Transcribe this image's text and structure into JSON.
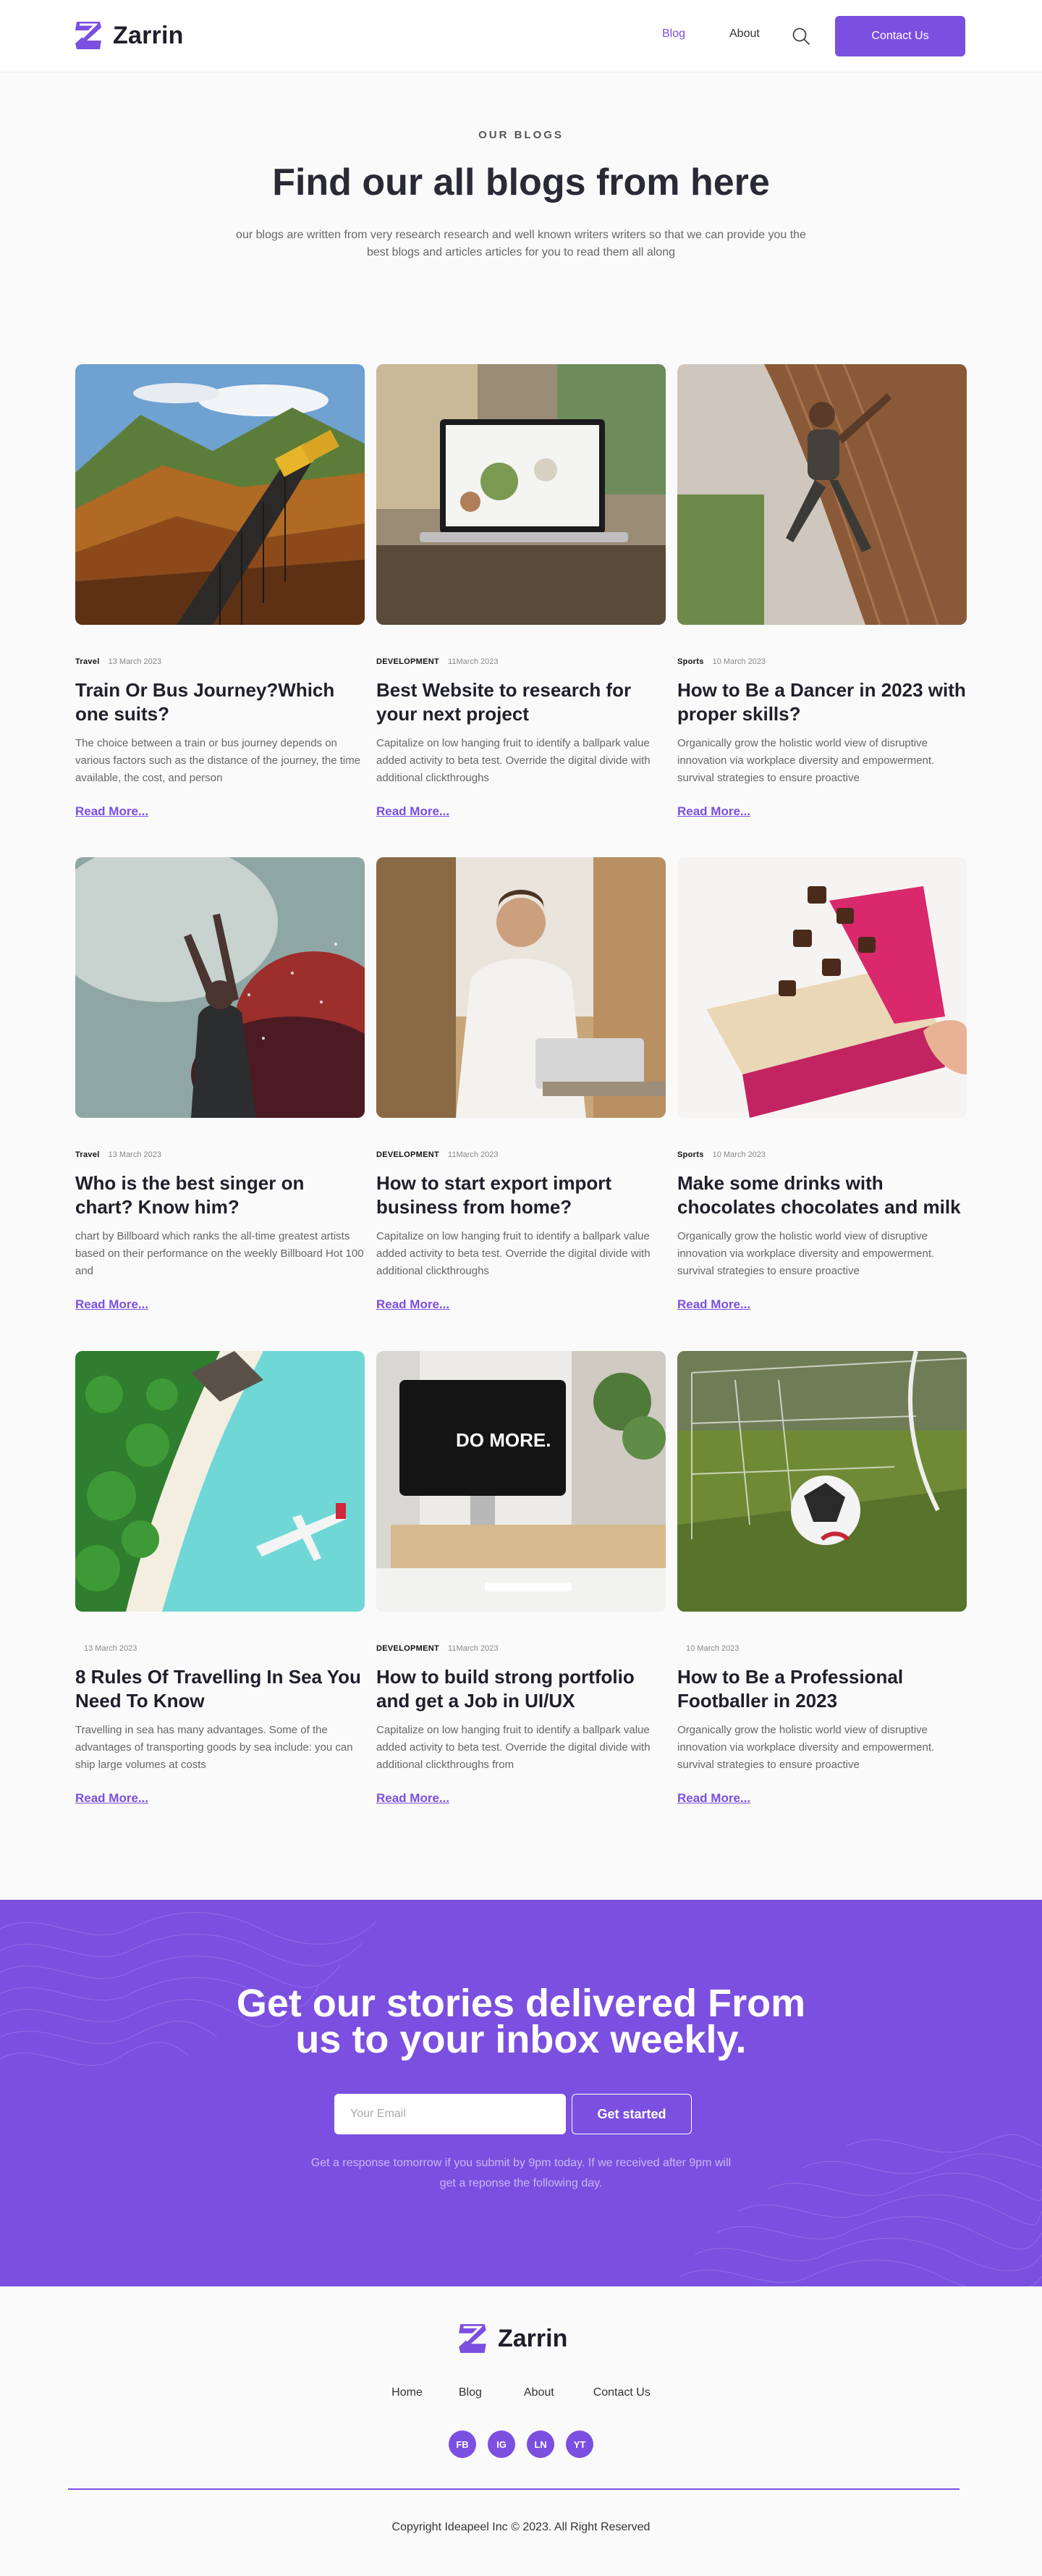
{
  "header": {
    "brand": "Zarrin",
    "nav": [
      {
        "label": "Blog"
      },
      {
        "label": "About"
      }
    ],
    "contact_label": "Contact Us"
  },
  "hero": {
    "eyebrow": "OUR BLOGS",
    "title": "Find our all blogs from here",
    "lead": "our blogs are written from very research research and well known writers writers so that  we can provide you the best blogs and articles articles for you to read them all along"
  },
  "posts": [
    {
      "category": "Travel",
      "date": "13 March 2023",
      "title": "Train Or Bus Journey?Which one suits?",
      "excerpt": "The choice between a train or bus journey depends on various factors such as the distance of the journey, the time available, the cost, and person",
      "more": "Read More..."
    },
    {
      "category": "DEVELOPMENT",
      "date": "11March 2023",
      "title": "Best Website to research for your next project",
      "excerpt": "Capitalize on low hanging fruit to identify a ballpark value added activity to beta test. Override the digital divide with additional clickthroughs",
      "more": "Read More..."
    },
    {
      "category": "Sports",
      "date": "10 March 2023",
      "title": "How to Be a Dancer in 2023 with proper skills?",
      "excerpt": "Organically grow the holistic world view of disruptive innovation via workplace diversity and empowerment. survival strategies to ensure proactive",
      "more": "Read More..."
    },
    {
      "category": "Travel",
      "date": "13 March 2023",
      "title": "Who is the best singer on chart? Know him?",
      "excerpt": "chart by Billboard which ranks the all-time greatest artists based on their performance on the weekly Billboard Hot 100 and",
      "more": "Read More..."
    },
    {
      "category": "DEVELOPMENT",
      "date": "11March 2023",
      "title": "How to start export import business from home?",
      "excerpt": "Capitalize on low hanging fruit to identify a ballpark value added activity to beta test. Override the digital divide with additional clickthroughs",
      "more": "Read More..."
    },
    {
      "category": "Sports",
      "date": "10 March 2023",
      "title": "Make some drinks with chocolates chocolates and milk",
      "excerpt": "Organically grow the holistic world view of disruptive innovation via workplace diversity and empowerment. survival strategies to ensure proactive",
      "more": "Read More..."
    },
    {
      "category": "",
      "date": "13 March 2023",
      "title": "8 Rules Of Travelling In Sea You Need To Know",
      "excerpt": "Travelling in sea has many advantages. Some of the advantages of transporting goods by sea include: you can ship large volumes at costs",
      "more": "Read More..."
    },
    {
      "category": "DEVELOPMENT",
      "date": "11March 2023",
      "title": "How to build strong portfolio and get a Job in UI/UX",
      "excerpt": "Capitalize on low hanging fruit to identify a ballpark value added activity to beta test. Override the digital divide with additional clickthroughs from",
      "more": "Read More..."
    },
    {
      "category": "",
      "date": "10 March 2023",
      "title": "How to Be a Professional Footballer in 2023",
      "excerpt": "Organically grow the holistic world view of disruptive innovation via workplace diversity and empowerment. survival strategies to ensure proactive",
      "more": "Read More..."
    }
  ],
  "monitor_text": "DO MORE.",
  "newsletter": {
    "title_line1": "Get our stories delivered From",
    "title_line2": "us to your inbox weekly.",
    "email_placeholder": "Your Email",
    "button": "Get started",
    "note": "Get a response tomorrow if you submit by 9pm today. If we received after 9pm will get a reponse the following day."
  },
  "footer": {
    "brand": "Zarrin",
    "links": [
      {
        "label": "Home"
      },
      {
        "label": "Blog"
      },
      {
        "label": "About"
      },
      {
        "label": "Contact Us"
      }
    ],
    "socials": [
      {
        "label": "FB"
      },
      {
        "label": "IG"
      },
      {
        "label": "LN"
      },
      {
        "label": "YT"
      }
    ],
    "copyright": "Copyright Ideapeel Inc © 2023. All Right Reserved"
  },
  "colors": {
    "accent": "#7b4fe0",
    "text": "#1f1f2b",
    "muted": "#666666"
  },
  "icons": {
    "logo": "zarrin-z-logo-icon",
    "search": "search-icon"
  }
}
